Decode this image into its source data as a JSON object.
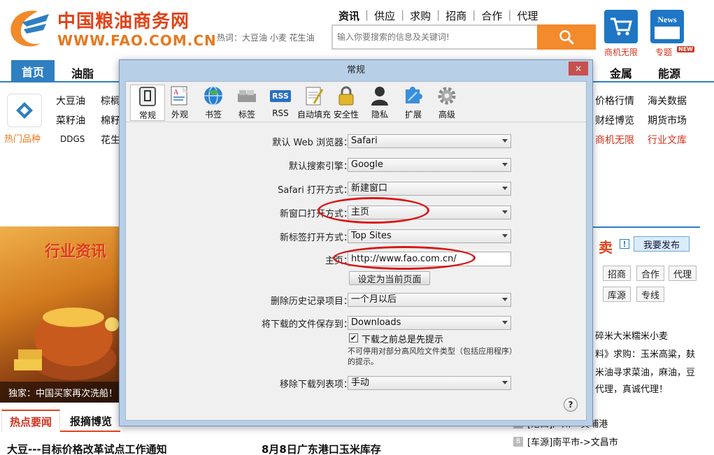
{
  "site": {
    "title": "中国粮油商务网",
    "url": "WWW.FAO.COM.CN",
    "top_links": [
      "资讯",
      "供应",
      "求购",
      "招商",
      "合作",
      "代理"
    ],
    "hotwords": "热词：大豆油 小麦 花生油",
    "search_placeholder": "输入你要搜索的信息及关键词!",
    "tile1_label": "商机无限",
    "tile2_label": "专题",
    "tile2_icon_text": "News",
    "new_badge": "NEW",
    "nav": {
      "home": "首页",
      "oils": "油脂",
      "metals": "金属",
      "energy": "能源"
    },
    "categories": {
      "hot_label": "热门品种",
      "soy_oil": "大豆油",
      "palm_partial": "棕榈",
      "rapeseed_oil": "菜籽油",
      "cotton_partial": "棉籽",
      "ddgs": "DDGS",
      "peanut_partial": "花生",
      "price": "价格行情",
      "customs": "海关数据",
      "finance": "财经博览",
      "futures": "期货市场",
      "biz": "商机无限",
      "library": "行业文库"
    },
    "hero_title": "行业资讯",
    "hero_caption": "独家：中国买家再次洗船！",
    "tabs": {
      "hot": "热点要闻",
      "news": "报摘博览"
    },
    "headlines": [
      "大豆---目标价格改革试点工作通知",
      "8月8日广东港口玉米库存"
    ],
    "right": {
      "sell_partial": "卖",
      "info_icon": "!",
      "publish": "我要发布",
      "buttons": [
        "招商",
        "合作",
        "代理",
        "库源",
        "专线"
      ],
      "text_lines": [
        "碎米大米糯米小麦",
        "料》求购：玉米高粱，麸",
        "米油寻求菜油，麻油，豆",
        "代理，真诚代理！"
      ],
      "items": [
        {
          "num": "",
          "text": "[港口]广州---黄埔港"
        },
        {
          "num": "8",
          "text": "[车源]南平市->文昌市"
        }
      ]
    }
  },
  "dialog": {
    "title": "常规",
    "close_icon": "×",
    "toolbar": [
      {
        "label": "常规",
        "icon": "switch-icon"
      },
      {
        "label": "外观",
        "icon": "appearance-icon"
      },
      {
        "label": "书签",
        "icon": "globe-icon"
      },
      {
        "label": "标签",
        "icon": "tabs-icon"
      },
      {
        "label": "RSS",
        "icon": "rss-icon"
      },
      {
        "label": "自动填充",
        "icon": "autofill-icon"
      },
      {
        "label": "安全性",
        "icon": "lock-icon"
      },
      {
        "label": "隐私",
        "icon": "person-icon"
      },
      {
        "label": "扩展",
        "icon": "puzzle-icon"
      },
      {
        "label": "高级",
        "icon": "gear-icon"
      }
    ],
    "rss_text": "RSS",
    "fields": {
      "default_browser_label": "默认 Web 浏览器：",
      "default_browser_value": "Safari",
      "search_engine_label": "默认搜索引擎：",
      "search_engine_value": "Google",
      "open_with_label": "Safari 打开方式：",
      "open_with_value": "新建窗口",
      "new_window_label": "新窗口打开方式：",
      "new_window_value": "主页",
      "new_tab_label": "新标签打开方式：",
      "new_tab_value": "Top Sites",
      "homepage_label": "主页：",
      "homepage_value": "http://www.fao.com.cn/",
      "set_current_button": "设定为当前页面",
      "remove_history_label": "删除历史记录项目：",
      "remove_history_value": "一个月以后",
      "save_downloads_label": "将下载的文件保存到：",
      "save_downloads_value": "Downloads",
      "ask_before_download_checked": true,
      "ask_before_download_label": "下载之前总是先提示",
      "note": "不可停用对部分高风险文件类型（包括应用程序）的提示。",
      "remove_downloads_label": "移除下载列表项：",
      "remove_downloads_value": "手动"
    },
    "checkbox_mark": "✔",
    "help": "?"
  },
  "colors": {
    "accent_blue": "#2f7fc1",
    "brand_red": "#e0431a",
    "annotation_red": "#d81818",
    "dialog_frame": "#b8cfe8"
  }
}
